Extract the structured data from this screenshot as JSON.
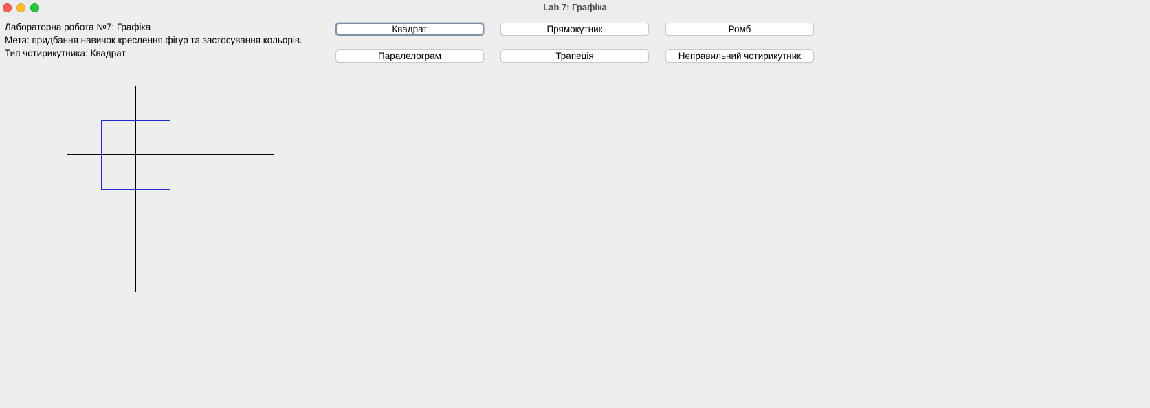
{
  "window": {
    "title": "Lab 7: Графіка"
  },
  "info": {
    "lab_title": "Лабораторна робота №7: Графіка",
    "goal": "Мета: придбання навичок креслення фігур та застосування кольорів.",
    "shape_type": "Тип чотирикутника: Квадрат"
  },
  "buttons": {
    "square": "Квадрат",
    "rectangle": "Прямокутник",
    "rhombus": "Ромб",
    "parallelogram": "Паралелограм",
    "trapezoid": "Трапеція",
    "irregular": "Неправильний чотирикутник"
  },
  "drawing": {
    "selected_shape": "Квадрат",
    "shape_color": "#1f2fcf",
    "axis_color": "#000000"
  }
}
